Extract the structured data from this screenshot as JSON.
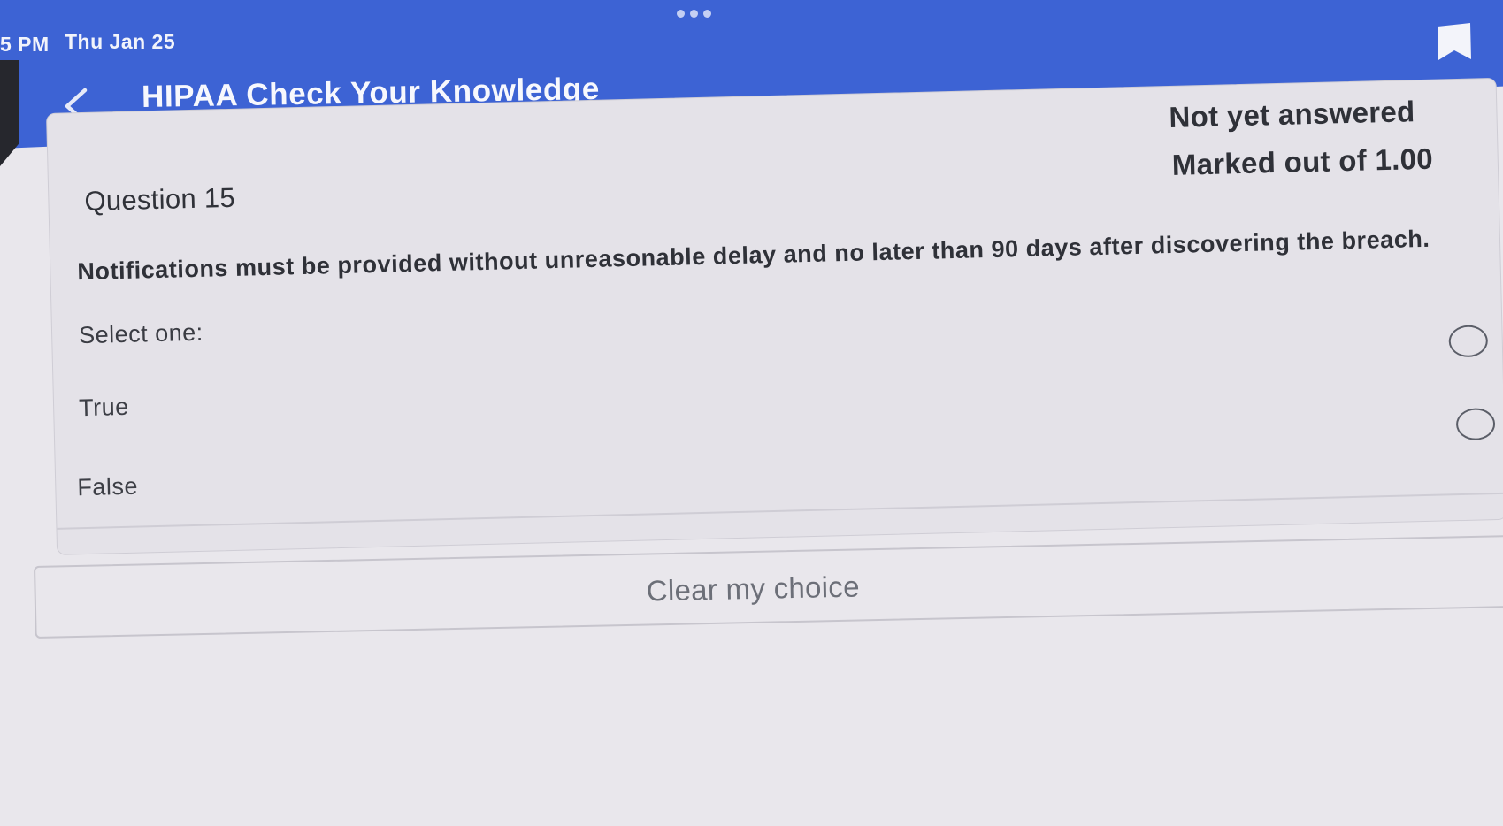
{
  "status_bar": {
    "time": "5 PM",
    "date": "Thu Jan 25"
  },
  "header": {
    "title": "HIPAA Check Your Knowledge",
    "back_icon": "chevron-left-icon",
    "bookmark_icon": "bookmark-icon"
  },
  "question": {
    "state": "Not yet answered",
    "marked": "Marked out of 1.00",
    "number": "Question 15",
    "text": "Notifications must be provided without unreasonable delay and no later than 90 days after discovering the breach.",
    "prompt": "Select one:",
    "options": [
      {
        "label": "True",
        "selected": false
      },
      {
        "label": "False",
        "selected": false
      }
    ],
    "clear_label": "Clear my choice"
  },
  "colors": {
    "header_blue": "#3d63d4",
    "page_background": "#e9e7ec",
    "text_dark": "#2f3138"
  }
}
